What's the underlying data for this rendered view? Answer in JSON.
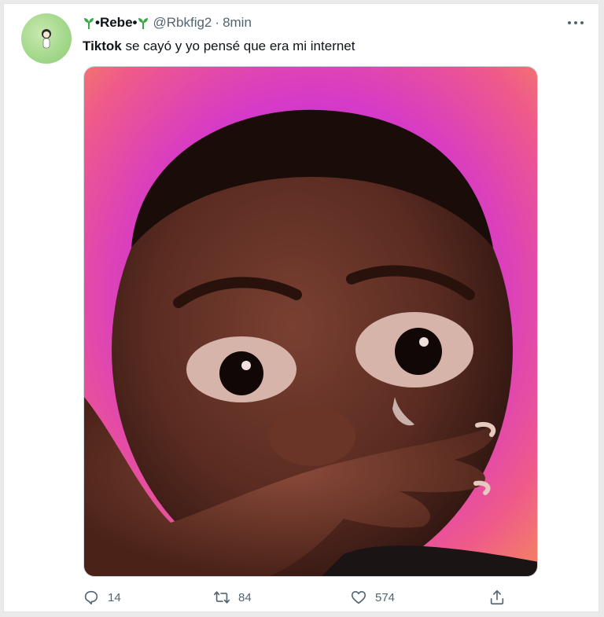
{
  "tweet": {
    "display_name": "•Rebe•",
    "handle": "@Rbkfig2",
    "separator": "·",
    "time": "8min",
    "text_bold": "Tiktok",
    "text_rest": " se cayó y yo pensé que era mi internet"
  },
  "icons": {
    "more": "more-horizontal-icon",
    "reply": "reply-icon",
    "retweet": "retweet-icon",
    "like": "heart-icon",
    "share": "share-icon",
    "name_decoration": "sprout-icon"
  },
  "actions": {
    "reply_count": "14",
    "retweet_count": "84",
    "like_count": "574"
  },
  "colors": {
    "text": "#0f1419",
    "muted": "#536471",
    "sprout": "#3aa849",
    "media_background": "#d63ac8"
  }
}
